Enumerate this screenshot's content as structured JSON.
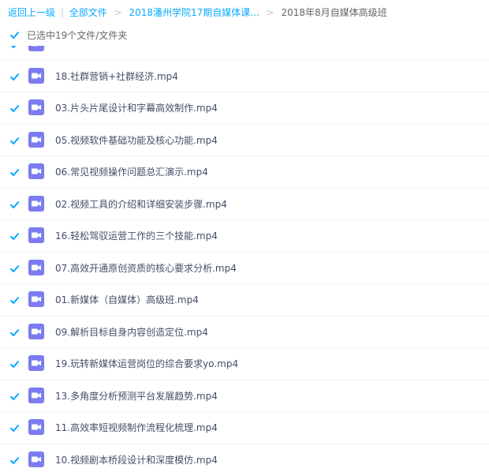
{
  "breadcrumb": {
    "back": "返回上一级",
    "divider": "|",
    "all_files": "全部文件",
    "separator": ">",
    "folder": "2018潘州学院17期自媒体课...",
    "current": "2018年8月自媒体高级班"
  },
  "selection": {
    "label": "已选中19个文件/文件夹",
    "all_checked": true
  },
  "colors": {
    "link": "#09AAFF",
    "checkbox": "#09AAFF",
    "video_icon": "#7b7cf1"
  },
  "files": [
    {
      "name": "",
      "checked": true,
      "icon": "video-icon"
    },
    {
      "name": "18.社群营销+社群经济.mp4",
      "checked": true,
      "icon": "video-icon"
    },
    {
      "name": "03.片头片尾设计和字幕高效制作.mp4",
      "checked": true,
      "icon": "video-icon"
    },
    {
      "name": "05.视频软件基础功能及核心功能.mp4",
      "checked": true,
      "icon": "video-icon"
    },
    {
      "name": "06.常见视频操作问题总汇演示.mp4",
      "checked": true,
      "icon": "video-icon"
    },
    {
      "name": "02.视频工具的介绍和详细安装步骤.mp4",
      "checked": true,
      "icon": "video-icon"
    },
    {
      "name": "16.轻松驾驭运营工作的三个技能.mp4",
      "checked": true,
      "icon": "video-icon"
    },
    {
      "name": "07.高效开通原创资质的核心要求分析.mp4",
      "checked": true,
      "icon": "video-icon"
    },
    {
      "name": "01.新媒体（自媒体）高级班.mp4",
      "checked": true,
      "icon": "video-icon"
    },
    {
      "name": "09.解析目标自身内容创造定位.mp4",
      "checked": true,
      "icon": "video-icon"
    },
    {
      "name": "19.玩转新媒体运营岗位的综合要求yo.mp4",
      "checked": true,
      "icon": "video-icon"
    },
    {
      "name": "13.多角度分析预测平台发展趋势.mp4",
      "checked": true,
      "icon": "video-icon"
    },
    {
      "name": "11.高效率短视频制作流程化梳理.mp4",
      "checked": true,
      "icon": "video-icon"
    },
    {
      "name": "10.视频剧本桥段设计和深度模仿.mp4",
      "checked": true,
      "icon": "video-icon"
    }
  ]
}
